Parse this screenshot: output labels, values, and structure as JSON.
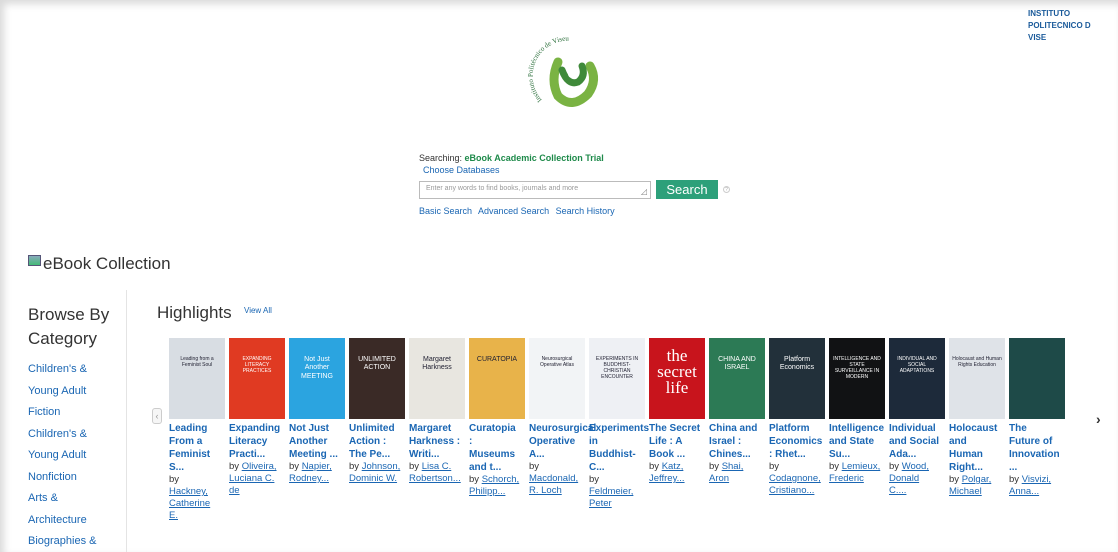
{
  "institution": {
    "lines": [
      "INSTITUTO",
      "POLITECNICO D",
      "VISE"
    ]
  },
  "logo": {
    "text": "Instituto Politécnico de Viseu"
  },
  "search": {
    "searching_label": "Searching:",
    "database_name": "eBook Academic Collection Trial",
    "choose_databases": "Choose Databases",
    "placeholder": "Enter any words to find books, journals and more",
    "button_label": "Search",
    "help_icon": "help-icon",
    "links": [
      "Basic Search",
      "Advanced Search",
      "Search History"
    ]
  },
  "collection": {
    "title": "eBook Collection",
    "icon": "ebook-collection-icon"
  },
  "sidebar": {
    "title_line1": "Browse By",
    "title_line2": "Category",
    "categories": [
      "Children's &",
      "Young Adult",
      "Fiction",
      "Children's &",
      "Young Adult",
      "Nonfiction",
      "Arts &",
      "Architecture",
      "Biographies &"
    ]
  },
  "highlights": {
    "title": "Highlights",
    "view_all": "View All"
  },
  "books": [
    {
      "title": "Leading\nFrom a\nFeminist\nS...",
      "by": "by",
      "author": "Hackney,\nCatherine\nE.",
      "author_prefix_by_newline": true,
      "cover_color": "#d8dde3",
      "cover_text": "Leading from a Feminist Soul"
    },
    {
      "title": "Expanding\nLiteracy\nPracti...",
      "by": "by",
      "author": "Oliveira,\nLuciana C.\nde",
      "cover_color": "#e03a22",
      "cover_text": "EXPANDING LITERACY PRACTICES"
    },
    {
      "title": "Not Just\nAnother\nMeeting ...",
      "by": "by",
      "author": "Napier,\nRodney...",
      "cover_color": "#2ba4e0",
      "cover_text": "Not Just Another MEETING"
    },
    {
      "title": "Unlimited\nAction :\nThe Pe...",
      "by": "by",
      "author": "Johnson,\nDominic W.",
      "cover_color": "#3a2a26",
      "cover_text": "UNLIMITED ACTION"
    },
    {
      "title": "Margaret\nHarkness :\nWriti...",
      "by": "by",
      "author": "Lisa C.\nRobertson...",
      "cover_color": "#e8e6e0",
      "cover_text": "Margaret Harkness"
    },
    {
      "title": "Curatopia\n:\nMuseums\nand t...",
      "by": "by",
      "author": "Schorch,\nPhilipp...",
      "cover_color": "#e8b34a",
      "cover_text": "CURATOPIA"
    },
    {
      "title": "Neurosurgical\nOperative\nA...",
      "by": "by",
      "author": "Macdonald,\nR. Loch",
      "cover_color": "#f2f4f6",
      "cover_text": "Neurosurgical Operative Atlas"
    },
    {
      "title": "Experiments\nin\nBuddhist-\nC...",
      "by": "by",
      "author": "Feldmeier,\nPeter",
      "cover_color": "#eef0f4",
      "cover_text": "EXPERIMENTS IN BUDDHIST-CHRISTIAN ENCOUNTER"
    },
    {
      "title": "The Secret\nLife : A\nBook ...",
      "by": "by",
      "author": "Katz,\nJeffrey...",
      "cover_color": "#c8141c",
      "cover_text": "the secret life"
    },
    {
      "title": "China and\nIsrael :\nChines...",
      "by": "by",
      "author": "Shai,\nAron",
      "cover_color": "#2c7a55",
      "cover_text": "CHINA AND ISRAEL"
    },
    {
      "title": "Platform\nEconomics\n: Rhet...",
      "by": "by",
      "author": "Codagnone,\nCristiano...",
      "cover_color": "#22303a",
      "cover_text": "Platform Economics"
    },
    {
      "title": "Intelligence\nand State\nSu...",
      "by": "by",
      "author": "Lemieux,\nFrederic",
      "cover_color": "#111214",
      "cover_text": "INTELLIGENCE AND STATE SURVEILLANCE IN MODERN"
    },
    {
      "title": "Individual\nand Social\nAda...",
      "by": "by",
      "author": "Wood,\nDonald\nC....",
      "cover_color": "#1d2a3a",
      "cover_text": "INDIVIDUAL AND SOCIAL ADAPTATIONS"
    },
    {
      "title": "Holocaust\nand\nHuman\nRight...",
      "by": "by",
      "author": "Polgar,\nMichael",
      "cover_color": "#dfe3e8",
      "cover_text": "Holocaust and Human Rights Education"
    },
    {
      "title": "The\nFuture of\nInnovation\n...",
      "by": "by",
      "author": "Visvizi,\nAnna...",
      "cover_color": "#1e4a48",
      "cover_text": ""
    }
  ],
  "carousel": {
    "prev_icon": "chevron-left-icon",
    "next_icon": "chevron-right-icon"
  },
  "colors": {
    "link": "#1a66b3",
    "accent": "#2da07a",
    "brand_green": "#1e8a4a"
  }
}
